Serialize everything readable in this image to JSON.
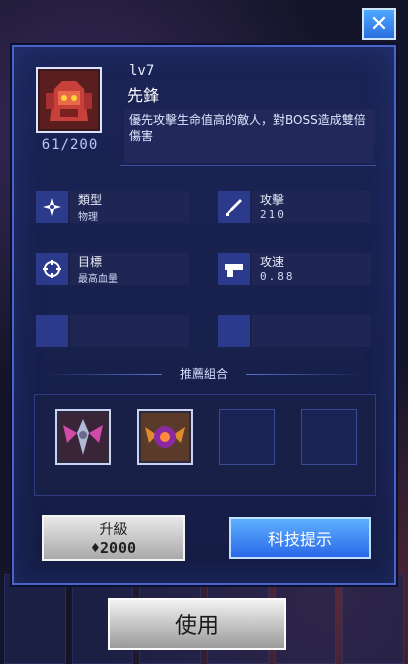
{
  "unit": {
    "level": "lv7",
    "name": "先鋒",
    "exp": "61/200",
    "description": "優先攻擊生命值高的敵人，對BOSS造成雙倍傷害"
  },
  "stats": [
    {
      "label": "類型",
      "value": "物理",
      "icon": "shuriken-icon"
    },
    {
      "label": "攻擊",
      "value": "210",
      "icon": "sword-icon"
    },
    {
      "label": "目標",
      "value": "最高血量",
      "icon": "crosshair-icon"
    },
    {
      "label": "攻速",
      "value": "0.88",
      "icon": "gun-icon"
    }
  ],
  "combo": {
    "title": "推薦組合"
  },
  "buttons": {
    "close": "✕",
    "upgrade": "升級",
    "upgrade_cost": "2000",
    "tip": "科技提示",
    "use": "使用"
  },
  "colors": {
    "panel_border": "#4a63c9",
    "primary_button": "#2a68e8",
    "secondary_button": "#a9a9a9"
  }
}
